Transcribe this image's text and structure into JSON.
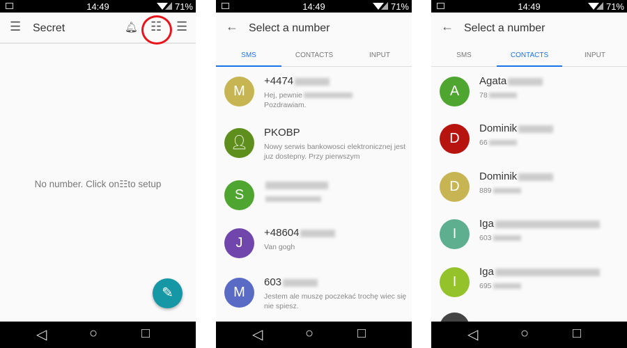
{
  "status": {
    "time": "14:49",
    "battery": "71%"
  },
  "screen1": {
    "title": "Secret",
    "empty_before": "No number. Click on",
    "empty_after": "to setup",
    "icons": [
      "menu-icon",
      "snooze-bell-icon",
      "list-icon",
      "tune-icon",
      "edit-pencil-icon"
    ],
    "highlight_color": "#e8141b",
    "fab_color": "#1697a6"
  },
  "picker": {
    "title": "Select a number",
    "tabs": [
      "SMS",
      "CONTACTS",
      "INPUT"
    ],
    "accent": "#1a73e8"
  },
  "sms": [
    {
      "initial": "M",
      "color": "#c7b553",
      "title": "+4474",
      "sub": "Hej, pewnie",
      "sub2": "Pozdrawiam."
    },
    {
      "initial": "",
      "icon": "person-icon",
      "color": "#5e8f1c",
      "title": "PKOBP",
      "sub": "Nowy serwis bankowosci elektronicznej jest juz dostepny. Przy pierwszym"
    },
    {
      "initial": "S",
      "color": "#4ea52f",
      "title": "",
      "sub": ""
    },
    {
      "initial": "J",
      "color": "#7046ad",
      "title": "+48604",
      "sub": "Van gogh"
    },
    {
      "initial": "M",
      "color": "#5a6bc6",
      "title": "603",
      "sub": "Jestem ale muszę poczekać trochę wiec się nie spiesz."
    }
  ],
  "contacts": [
    {
      "initial": "A",
      "color": "#4ea52f",
      "title": "Agata",
      "sub": "78"
    },
    {
      "initial": "D",
      "color": "#b8140f",
      "title": "Dominik",
      "sub": "66"
    },
    {
      "initial": "D",
      "color": "#c7b553",
      "title": "Dominik",
      "sub": "889"
    },
    {
      "initial": "I",
      "color": "#5eae90",
      "title": "Iga",
      "sub": "603"
    },
    {
      "initial": "I",
      "color": "#93c22a",
      "title": "Iga",
      "sub": "695"
    }
  ]
}
